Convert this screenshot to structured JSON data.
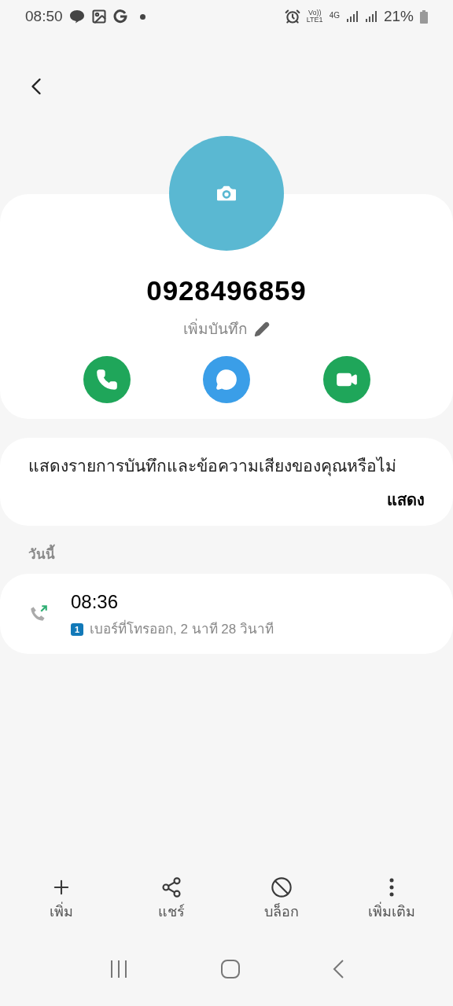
{
  "status_bar": {
    "time": "08:50",
    "volte": "Vo))",
    "lte": "LTE1",
    "network": "4G",
    "battery": "21%"
  },
  "contact": {
    "number": "0928496859",
    "note_link": "เพิ่มบันทึก"
  },
  "prompt": {
    "message": "แสดงรายการบันทึกและข้อความเสียงของคุณหรือไม่",
    "action": "แสดง"
  },
  "history": {
    "section": "วันนี้",
    "calls": [
      {
        "time": "08:36",
        "sim": "1",
        "detail": "เบอร์ที่โทรออก, 2 นาที 28 วินาที"
      }
    ]
  },
  "toolbar": [
    {
      "kind": "add",
      "label": "เพิ่ม"
    },
    {
      "kind": "share",
      "label": "แชร์"
    },
    {
      "kind": "block",
      "label": "บล็อก"
    },
    {
      "kind": "more",
      "label": "เพิ่มเติม"
    }
  ]
}
